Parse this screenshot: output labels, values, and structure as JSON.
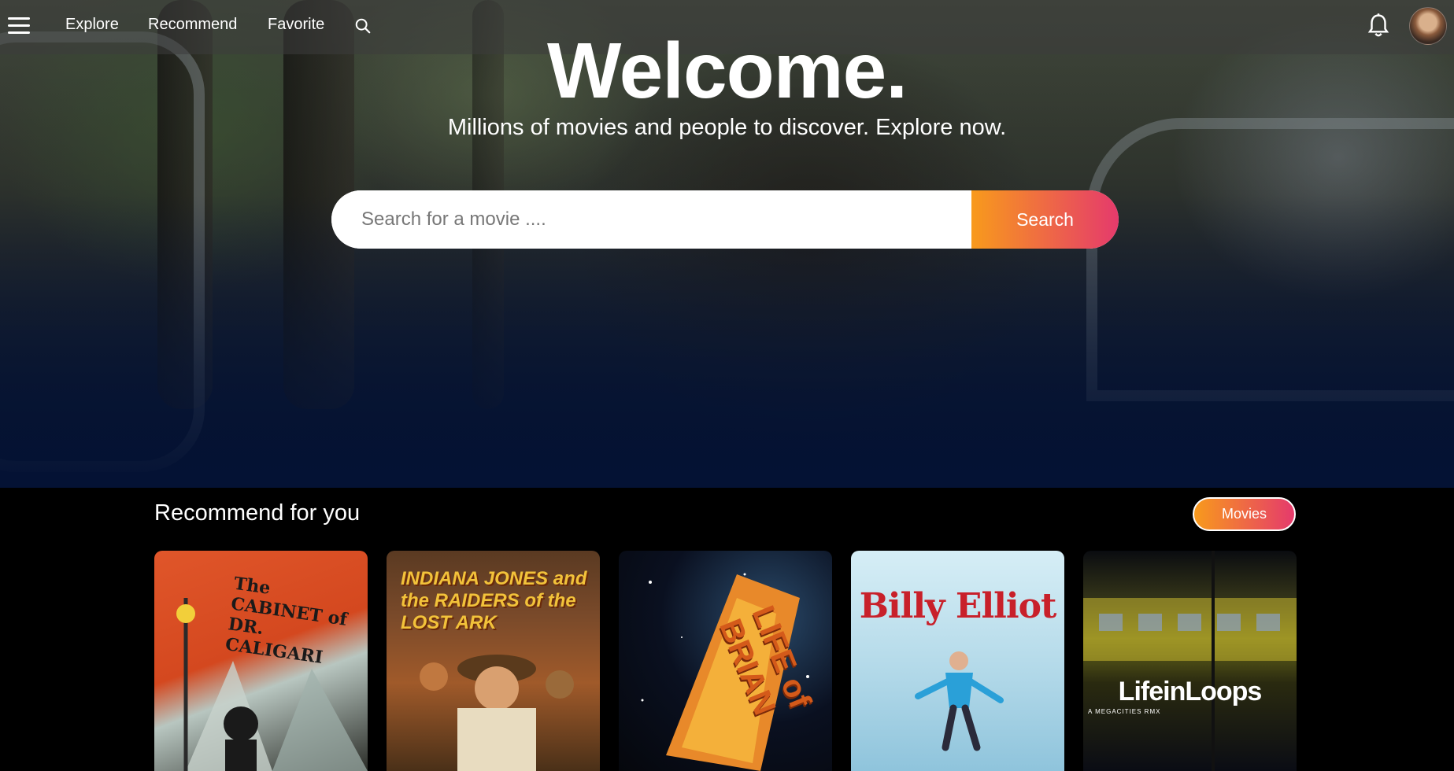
{
  "nav": {
    "menu_icon": "hamburger-menu-icon",
    "links": [
      {
        "label": "Explore"
      },
      {
        "label": "Recommend"
      },
      {
        "label": "Favorite"
      }
    ],
    "search_icon": "search-icon",
    "notification_icon": "bell-icon",
    "avatar": "user-avatar"
  },
  "hero": {
    "title": "Welcome.",
    "subtitle": "Millions of movies and people to discover. Explore now.",
    "search": {
      "placeholder": "Search for a movie ....",
      "value": "",
      "button_label": "Search"
    }
  },
  "recommend": {
    "title": "Recommend for you",
    "toggle_label": "Movies",
    "movies": [
      {
        "poster_text": "The CABINET of DR. CALIGARI"
      },
      {
        "poster_text": "INDIANA JONES and the RAIDERS of the LOST ARK"
      },
      {
        "poster_text": "LIFE of BRIAN"
      },
      {
        "poster_text": "Billy Elliot"
      },
      {
        "poster_text": "LifeinLoops",
        "poster_subtext": "A MEGACITIES RMX"
      }
    ]
  },
  "colors": {
    "accent_start": "#f89a1c",
    "accent_end": "#e53a6c",
    "background": "#000000",
    "hero_bottom": "#061330"
  }
}
